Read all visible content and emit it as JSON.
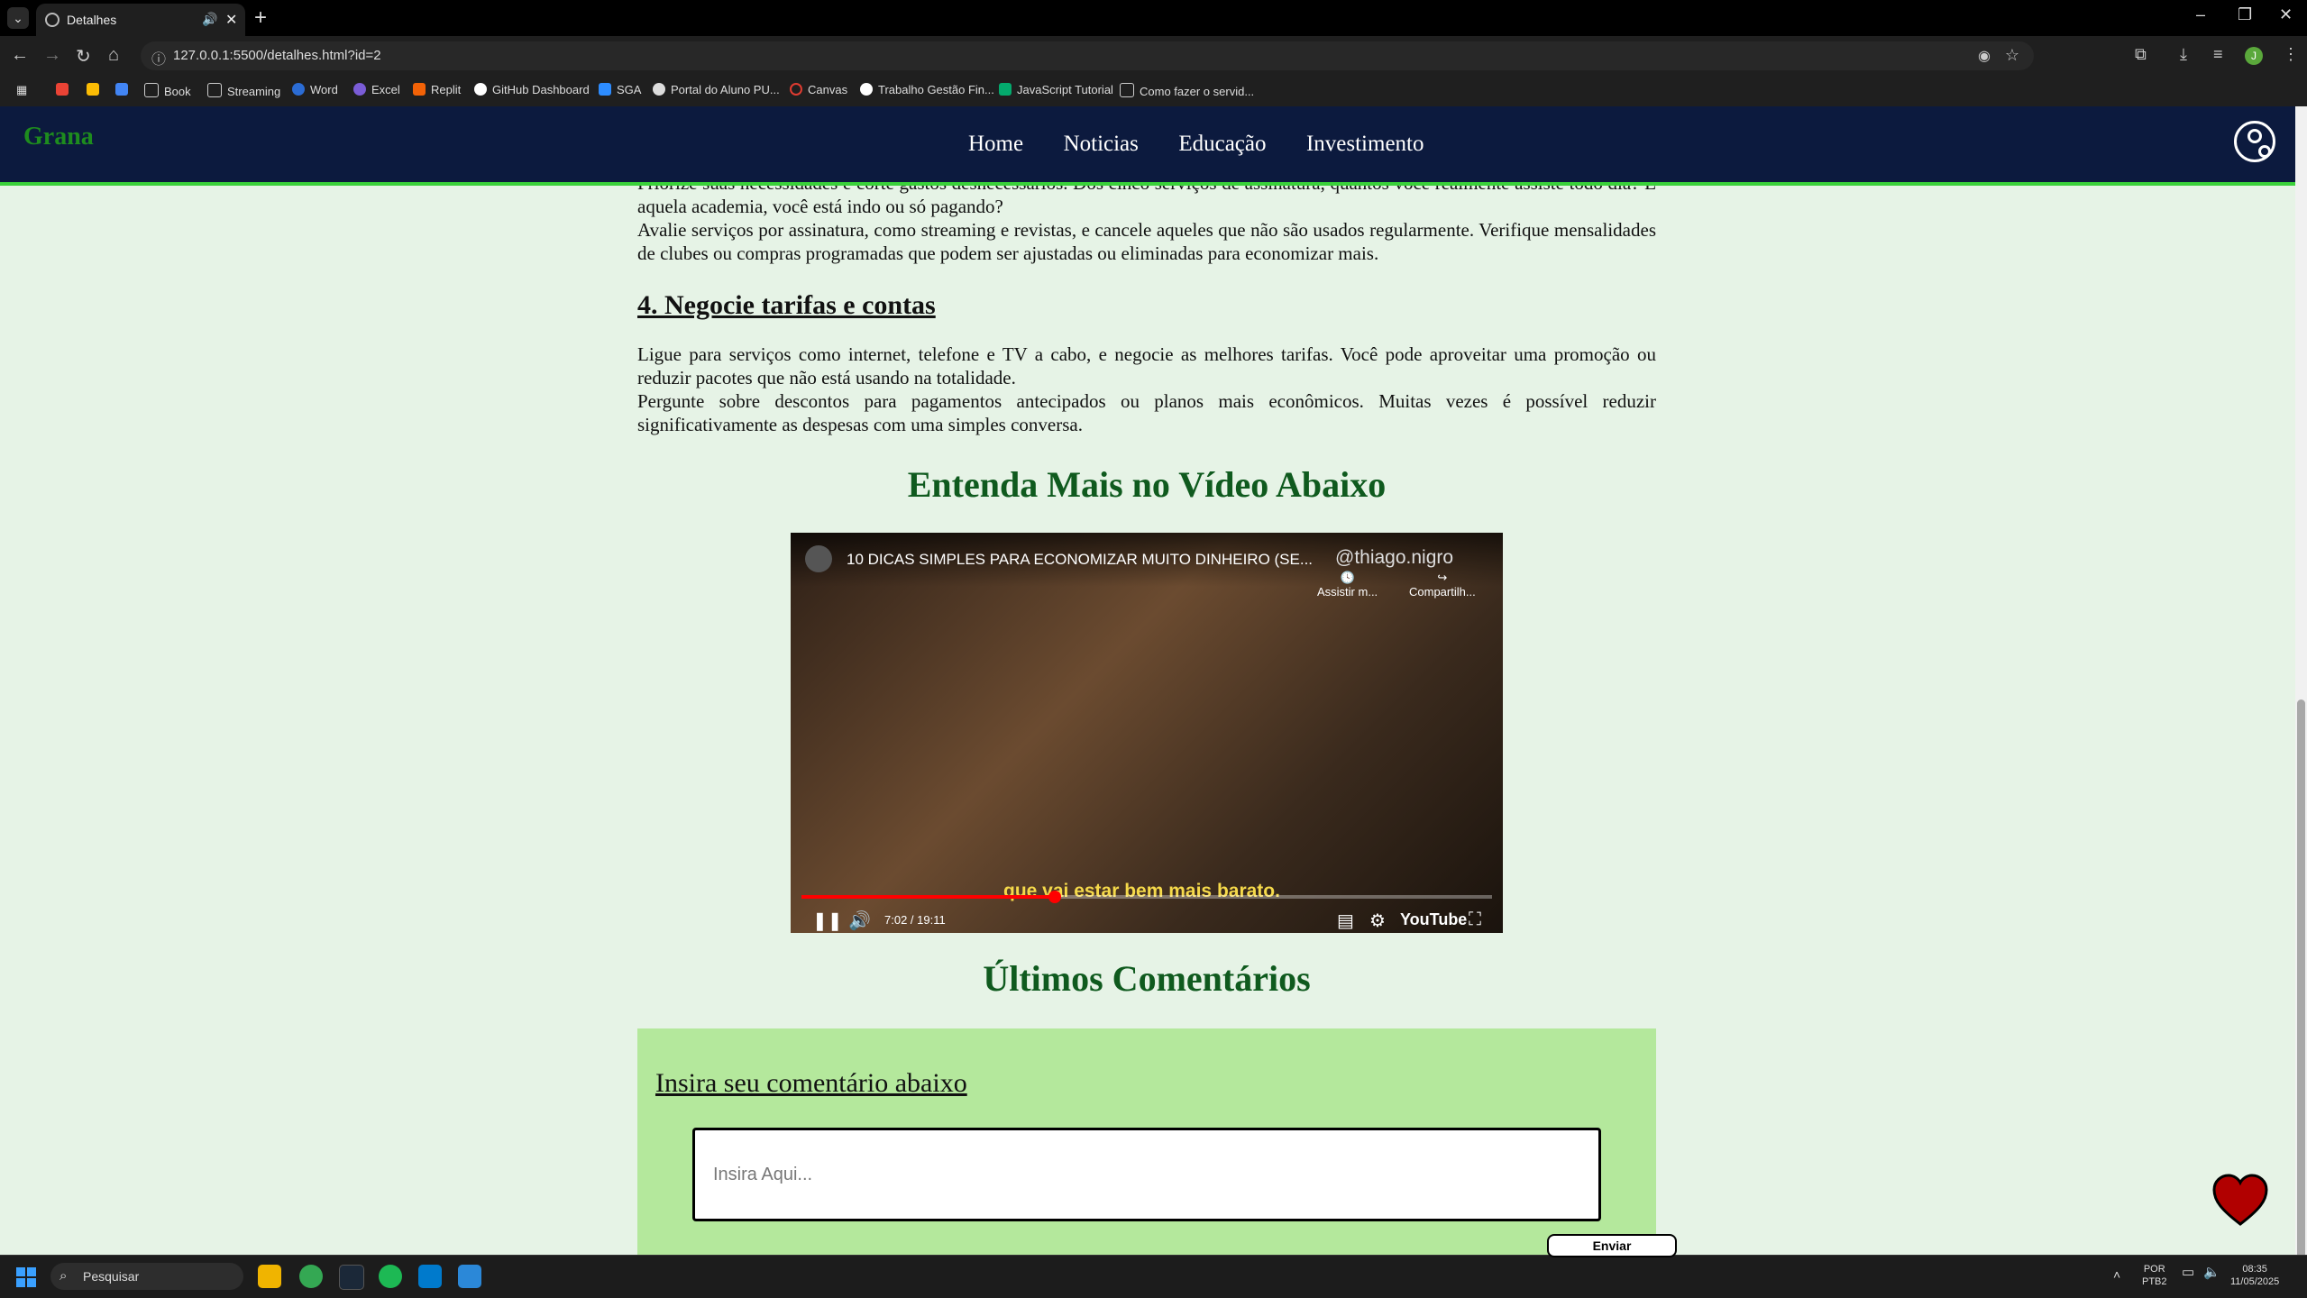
{
  "browser": {
    "tab_title": "Detalhes",
    "url": "127.0.0.1:5500/detalhes.html?id=2",
    "bookmarks": [
      "Book",
      "Streaming",
      "Word",
      "Excel",
      "Replit",
      "GitHub Dashboard",
      "SGA",
      "Portal do Aluno PU...",
      "Canvas",
      "Trabalho Gestão Fin...",
      "JavaScript Tutorial",
      "Como fazer o servid..."
    ],
    "profile_initial": "J"
  },
  "site": {
    "logo": "Grana",
    "nav": [
      "Home",
      "Noticias",
      "Educação",
      "Investimento"
    ]
  },
  "article": {
    "p1": "Priorize suas necessidades e corte gastos desnecessários. Dos cinco serviços de assinatura, quantos você realmente assiste todo dia? E aquela academia, você está indo ou só pagando?",
    "p2": "Avalie serviços por assinatura, como streaming e revistas, e cancele aqueles que não são usados regularmente. Verifique mensalidades de clubes ou compras programadas que podem ser ajustadas ou eliminadas para economizar mais.",
    "h4": "4. Negocie tarifas e contas",
    "p3": "Ligue para serviços como internet, telefone e TV a cabo, e negocie as melhores tarifas. Você pode aproveitar uma promoção ou reduzir pacotes que não está usando na totalidade.",
    "p4": "Pergunte sobre descontos para pagamentos antecipados ou planos mais econômicos. Muitas vezes é possível reduzir significativamente as despesas com uma simples conversa."
  },
  "video_section": {
    "title": "Entenda Mais no Vídeo Abaixo",
    "video_title": "10 DICAS SIMPLES PARA ECONOMIZAR MUITO DINHEIRO (SE...",
    "watermark": "@thiago.nigro",
    "watch_later": "Assistir m...",
    "share": "Compartilh...",
    "caption": "que vai estar bem mais barato.",
    "time": "7:02 / 19:11",
    "progress": 0.367,
    "brand": "YouTube"
  },
  "comments": {
    "title": "Últimos Comentários",
    "label": "Insira seu comentário abaixo",
    "placeholder": "Insira Aqui...",
    "send": "Enviar"
  },
  "taskbar": {
    "search": "Pesquisar",
    "lang": "POR",
    "layout": "PTB2",
    "time": "08:35",
    "date": "11/05/2025"
  },
  "colors": {
    "header_bg": "#0c1a3e",
    "accent_green": "#3ad13a",
    "title_green": "#0f5a1e",
    "comment_bg": "#b4e89c",
    "page_bg": "#e6f3e6"
  }
}
